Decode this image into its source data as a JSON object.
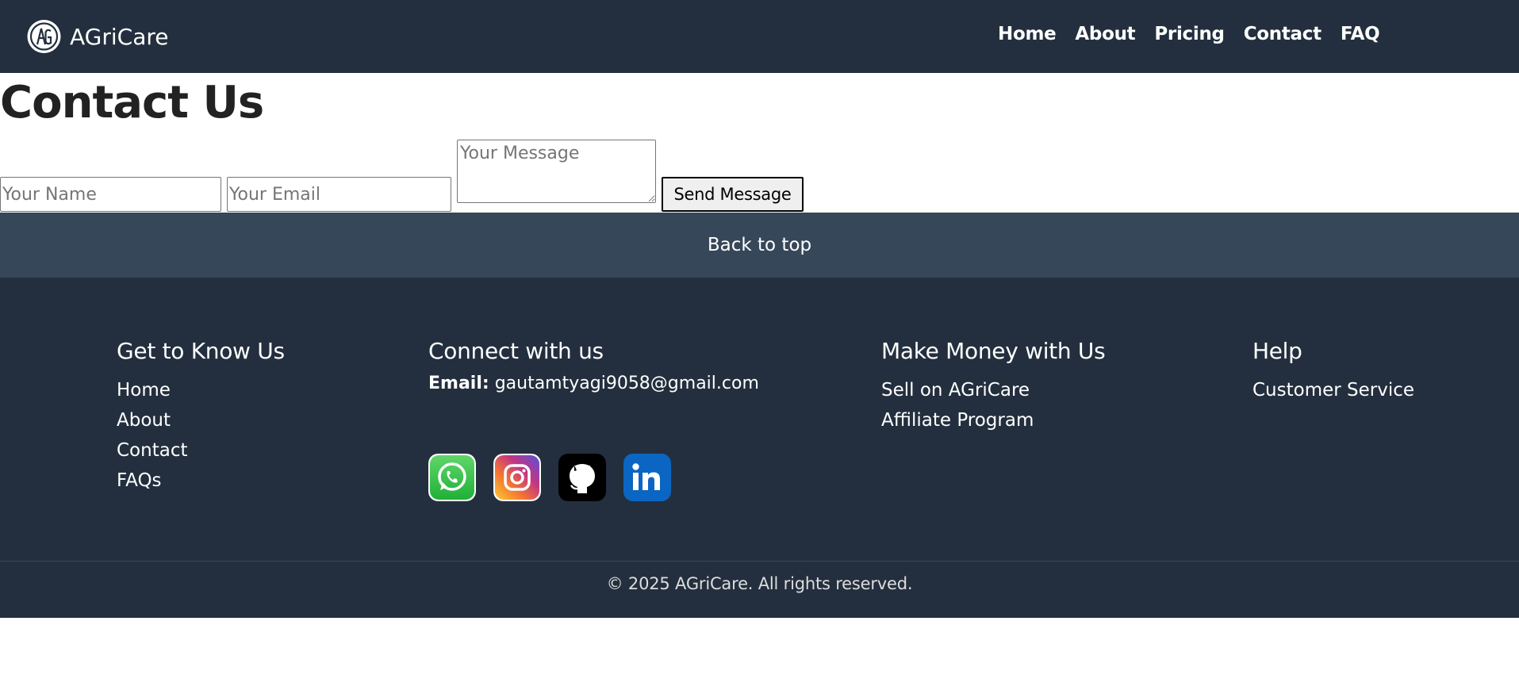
{
  "header": {
    "brand_name": "AGriCare",
    "nav": [
      "Home",
      "About",
      "Pricing",
      "Contact",
      "FAQ"
    ]
  },
  "main": {
    "title": "Contact Us",
    "form": {
      "name_placeholder": "Your Name",
      "email_placeholder": "Your Email",
      "message_placeholder": "Your Message",
      "submit_label": "Send Message"
    }
  },
  "back_to_top": "Back to top",
  "footer": {
    "columns": [
      {
        "title": "Get to Know Us",
        "links": [
          "Home",
          "About",
          "Contact",
          "FAQs"
        ]
      },
      {
        "title": "Connect with us",
        "email_label": "Email:",
        "email": "gautamtyagi9058@gmail.com",
        "socials": [
          "whatsapp-icon",
          "instagram-icon",
          "github-icon",
          "linkedin-icon"
        ]
      },
      {
        "title": "Make Money with Us",
        "links": [
          "Sell on AGriCare",
          "Affiliate Program"
        ]
      },
      {
        "title": "Help",
        "links": [
          "Customer Service"
        ]
      }
    ],
    "copyright": "© 2025 AGriCare. All rights reserved."
  },
  "colors": {
    "navbar": "#232f3e",
    "back_to_top": "#37475a",
    "footer": "#232f3e"
  }
}
